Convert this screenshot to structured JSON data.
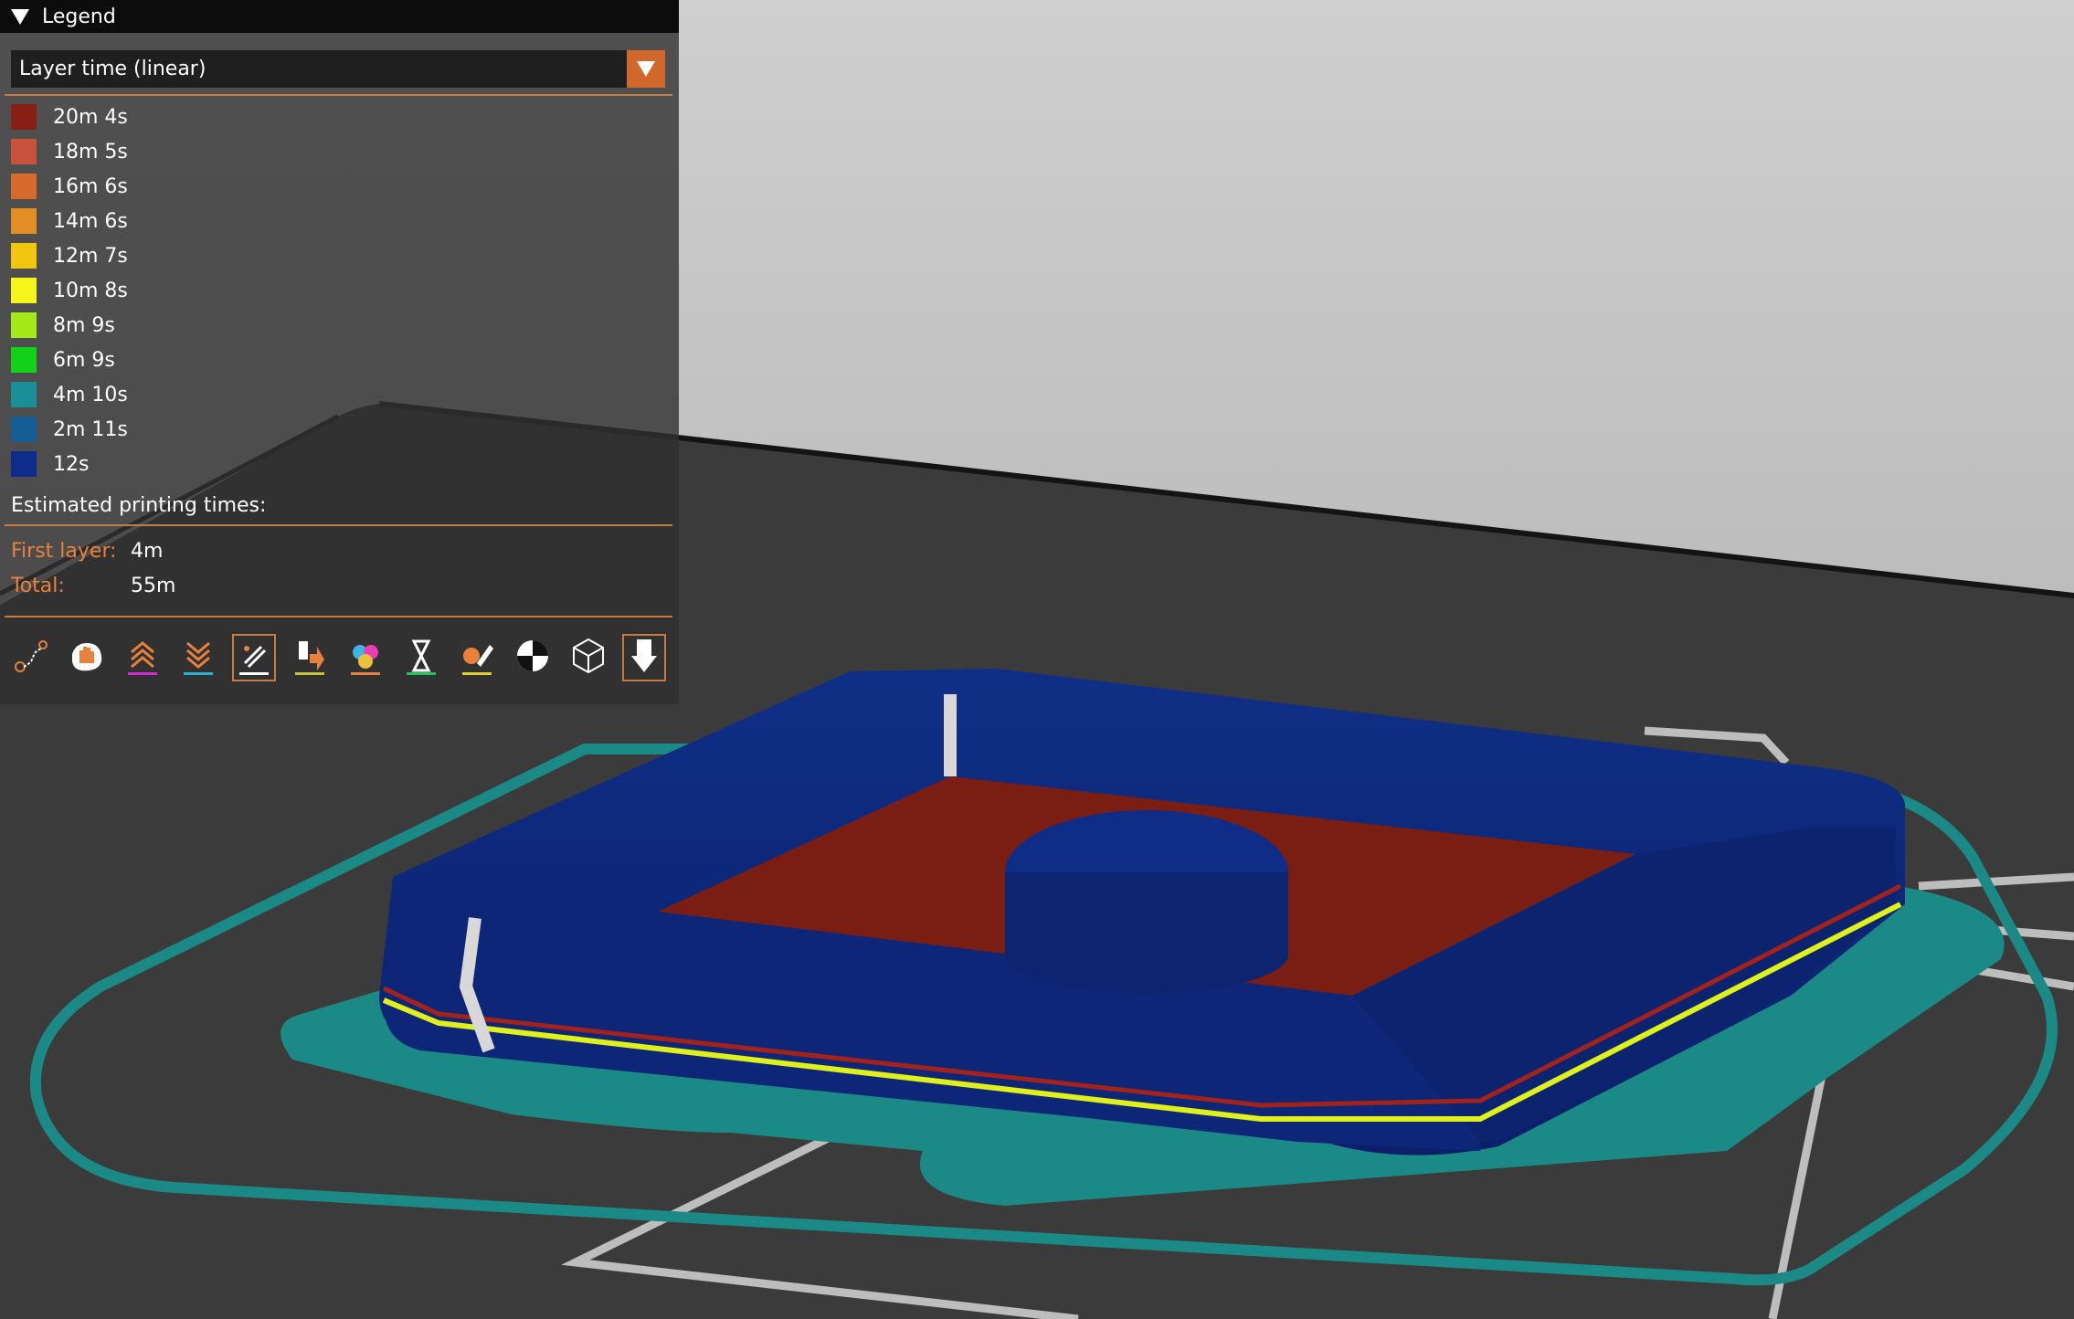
{
  "legend": {
    "title": "Legend",
    "view_type": "Layer time (linear)",
    "items": [
      {
        "label": "20m 4s",
        "color": "#8a2015"
      },
      {
        "label": "18m 5s",
        "color": "#c8523c"
      },
      {
        "label": "16m 6s",
        "color": "#d66a2c"
      },
      {
        "label": "14m 6s",
        "color": "#e38d25"
      },
      {
        "label": "12m 7s",
        "color": "#f2c511"
      },
      {
        "label": "10m 8s",
        "color": "#f6f51b"
      },
      {
        "label": "8m 9s",
        "color": "#a4e81a"
      },
      {
        "label": "6m 9s",
        "color": "#12d11a"
      },
      {
        "label": "4m 10s",
        "color": "#1b8f97"
      },
      {
        "label": "2m 11s",
        "color": "#155d95"
      },
      {
        "label": "12s",
        "color": "#0f2c8c"
      }
    ],
    "times_title": "Estimated printing times:",
    "first_layer_label": "First layer:",
    "first_layer_value": "4m",
    "total_label": "Total:",
    "total_value": "55m"
  },
  "toolbar": [
    {
      "icon": "travel-path-icon",
      "active": false
    },
    {
      "icon": "wipe-icon",
      "active": false
    },
    {
      "icon": "retractions-icon",
      "active": false
    },
    {
      "icon": "deretractions-icon",
      "active": false
    },
    {
      "icon": "seams-icon",
      "active": true
    },
    {
      "icon": "tool-changes-icon",
      "active": false
    },
    {
      "icon": "color-changes-icon",
      "active": false
    },
    {
      "icon": "pause-icon",
      "active": false
    },
    {
      "icon": "custom-gcode-icon",
      "active": false
    },
    {
      "icon": "center-of-gravity-icon",
      "active": false
    },
    {
      "icon": "shells-icon",
      "active": false
    },
    {
      "icon": "tool-marker-icon",
      "active": true
    }
  ],
  "colors": {
    "accent": "#d1672a",
    "model_wall": "#102a86",
    "model_floor": "#7a1e14",
    "skirt": "#1a8a86",
    "bed": "#3a3a3a",
    "background_top": "#b8b8b8"
  }
}
